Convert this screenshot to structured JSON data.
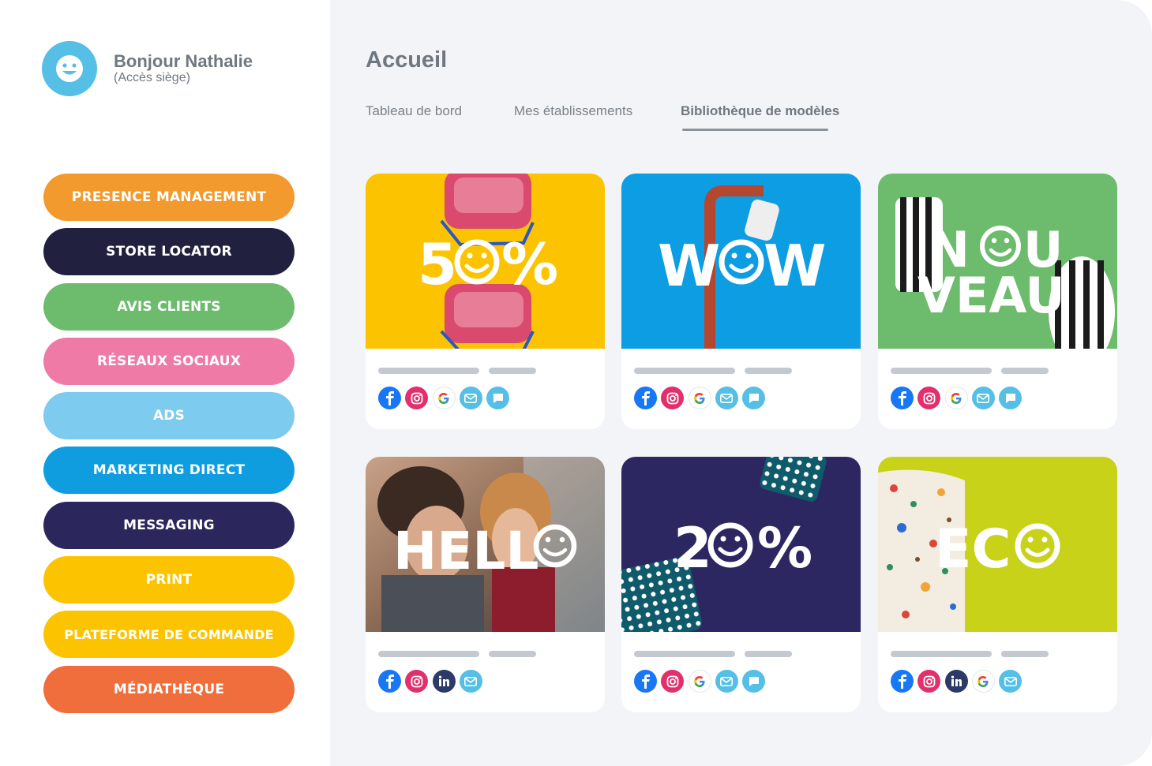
{
  "user": {
    "greeting": "Bonjour Nathalie",
    "role": "(Accès siège)"
  },
  "menu": [
    {
      "label": "PRESENCE MANAGEMENT",
      "color": "#f29a2e"
    },
    {
      "label": "STORE LOCATOR",
      "color": "#21203f"
    },
    {
      "label": "AVIS CLIENTS",
      "color": "#6dbb6c"
    },
    {
      "label": "RÉSEAUX SOCIAUX",
      "color": "#ef7aa6"
    },
    {
      "label": "ADS",
      "color": "#7dcbef"
    },
    {
      "label": "MARKETING DIRECT",
      "color": "#0f9de0"
    },
    {
      "label": "MESSAGING",
      "color": "#2b275c"
    },
    {
      "label": "PRINT",
      "color": "#fcc400"
    },
    {
      "label": "PLATEFORME DE COMMANDE",
      "color": "#fcc400"
    },
    {
      "label": "MÉDIATHÈQUE",
      "color": "#ef6e3b"
    }
  ],
  "page": {
    "title": "Accueil",
    "tabs": [
      "Tableau de bord",
      "Mes établissements",
      "Bibliothèque de modèles"
    ],
    "active_tab": "Bibliothèque de modèles"
  },
  "cards": [
    {
      "text_before": "5",
      "text_after": "%",
      "bg": "#fcc400",
      "icons": [
        "facebook-icon",
        "instagram-icon",
        "google-icon",
        "email-icon",
        "message-icon"
      ]
    },
    {
      "text_before": "W",
      "text_after": "W",
      "bg": "#0d9de2",
      "icons": [
        "facebook-icon",
        "instagram-icon",
        "google-icon",
        "email-icon",
        "message-icon"
      ]
    },
    {
      "text_before": "N",
      "text_after": "U",
      "line2": "VEAU",
      "bg": "#6dbb6c",
      "icons": [
        "facebook-icon",
        "instagram-icon",
        "google-icon",
        "email-icon",
        "message-icon"
      ]
    },
    {
      "text_before": "HELL",
      "text_after": "",
      "bg": "#8a6a55",
      "icons": [
        "facebook-icon",
        "instagram-icon",
        "linkedin-icon",
        "email-icon"
      ]
    },
    {
      "text_before": "2",
      "text_after": "%",
      "bg": "#2c2761",
      "icons": [
        "facebook-icon",
        "instagram-icon",
        "google-icon",
        "email-icon",
        "message-icon"
      ]
    },
    {
      "text_before": "EC",
      "text_after": "",
      "bg": "#c8d219",
      "icons": [
        "facebook-icon",
        "instagram-icon",
        "linkedin-icon",
        "google-icon",
        "email-icon"
      ]
    }
  ]
}
